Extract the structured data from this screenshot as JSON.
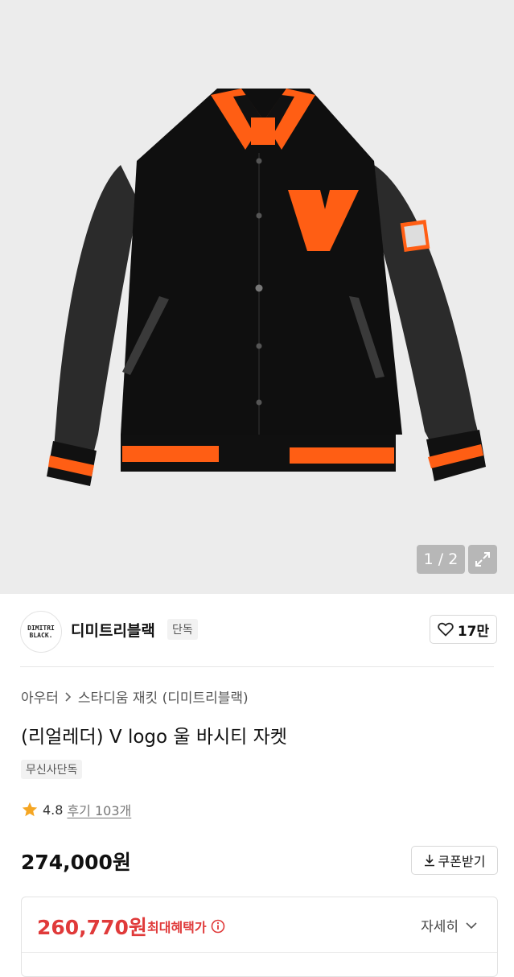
{
  "gallery": {
    "counter": "1 / 2",
    "patch_letter": "V"
  },
  "brand": {
    "logo_line1": "DIMITRI",
    "logo_line2": "BLACK.",
    "name": "디미트리블랙",
    "tag": "단독",
    "likes": "17만"
  },
  "breadcrumb": {
    "category": "아우터",
    "subcategory": "스타디움 재킷 (디미트리블랙)"
  },
  "product": {
    "title": "(리얼레더) V logo 울 바시티 자켓",
    "tag": "무신사단독",
    "rating": "4.8",
    "review_label": "후기 103개",
    "price": "274,000원",
    "coupon_label": "쿠폰받기"
  },
  "benefit": {
    "price": "260,770원",
    "label": "최대혜택가",
    "detail_label": "자세히"
  },
  "colors": {
    "accent_red": "#e03a3a",
    "star": "#f5a623",
    "jacket_orange": "#ff5e14"
  }
}
